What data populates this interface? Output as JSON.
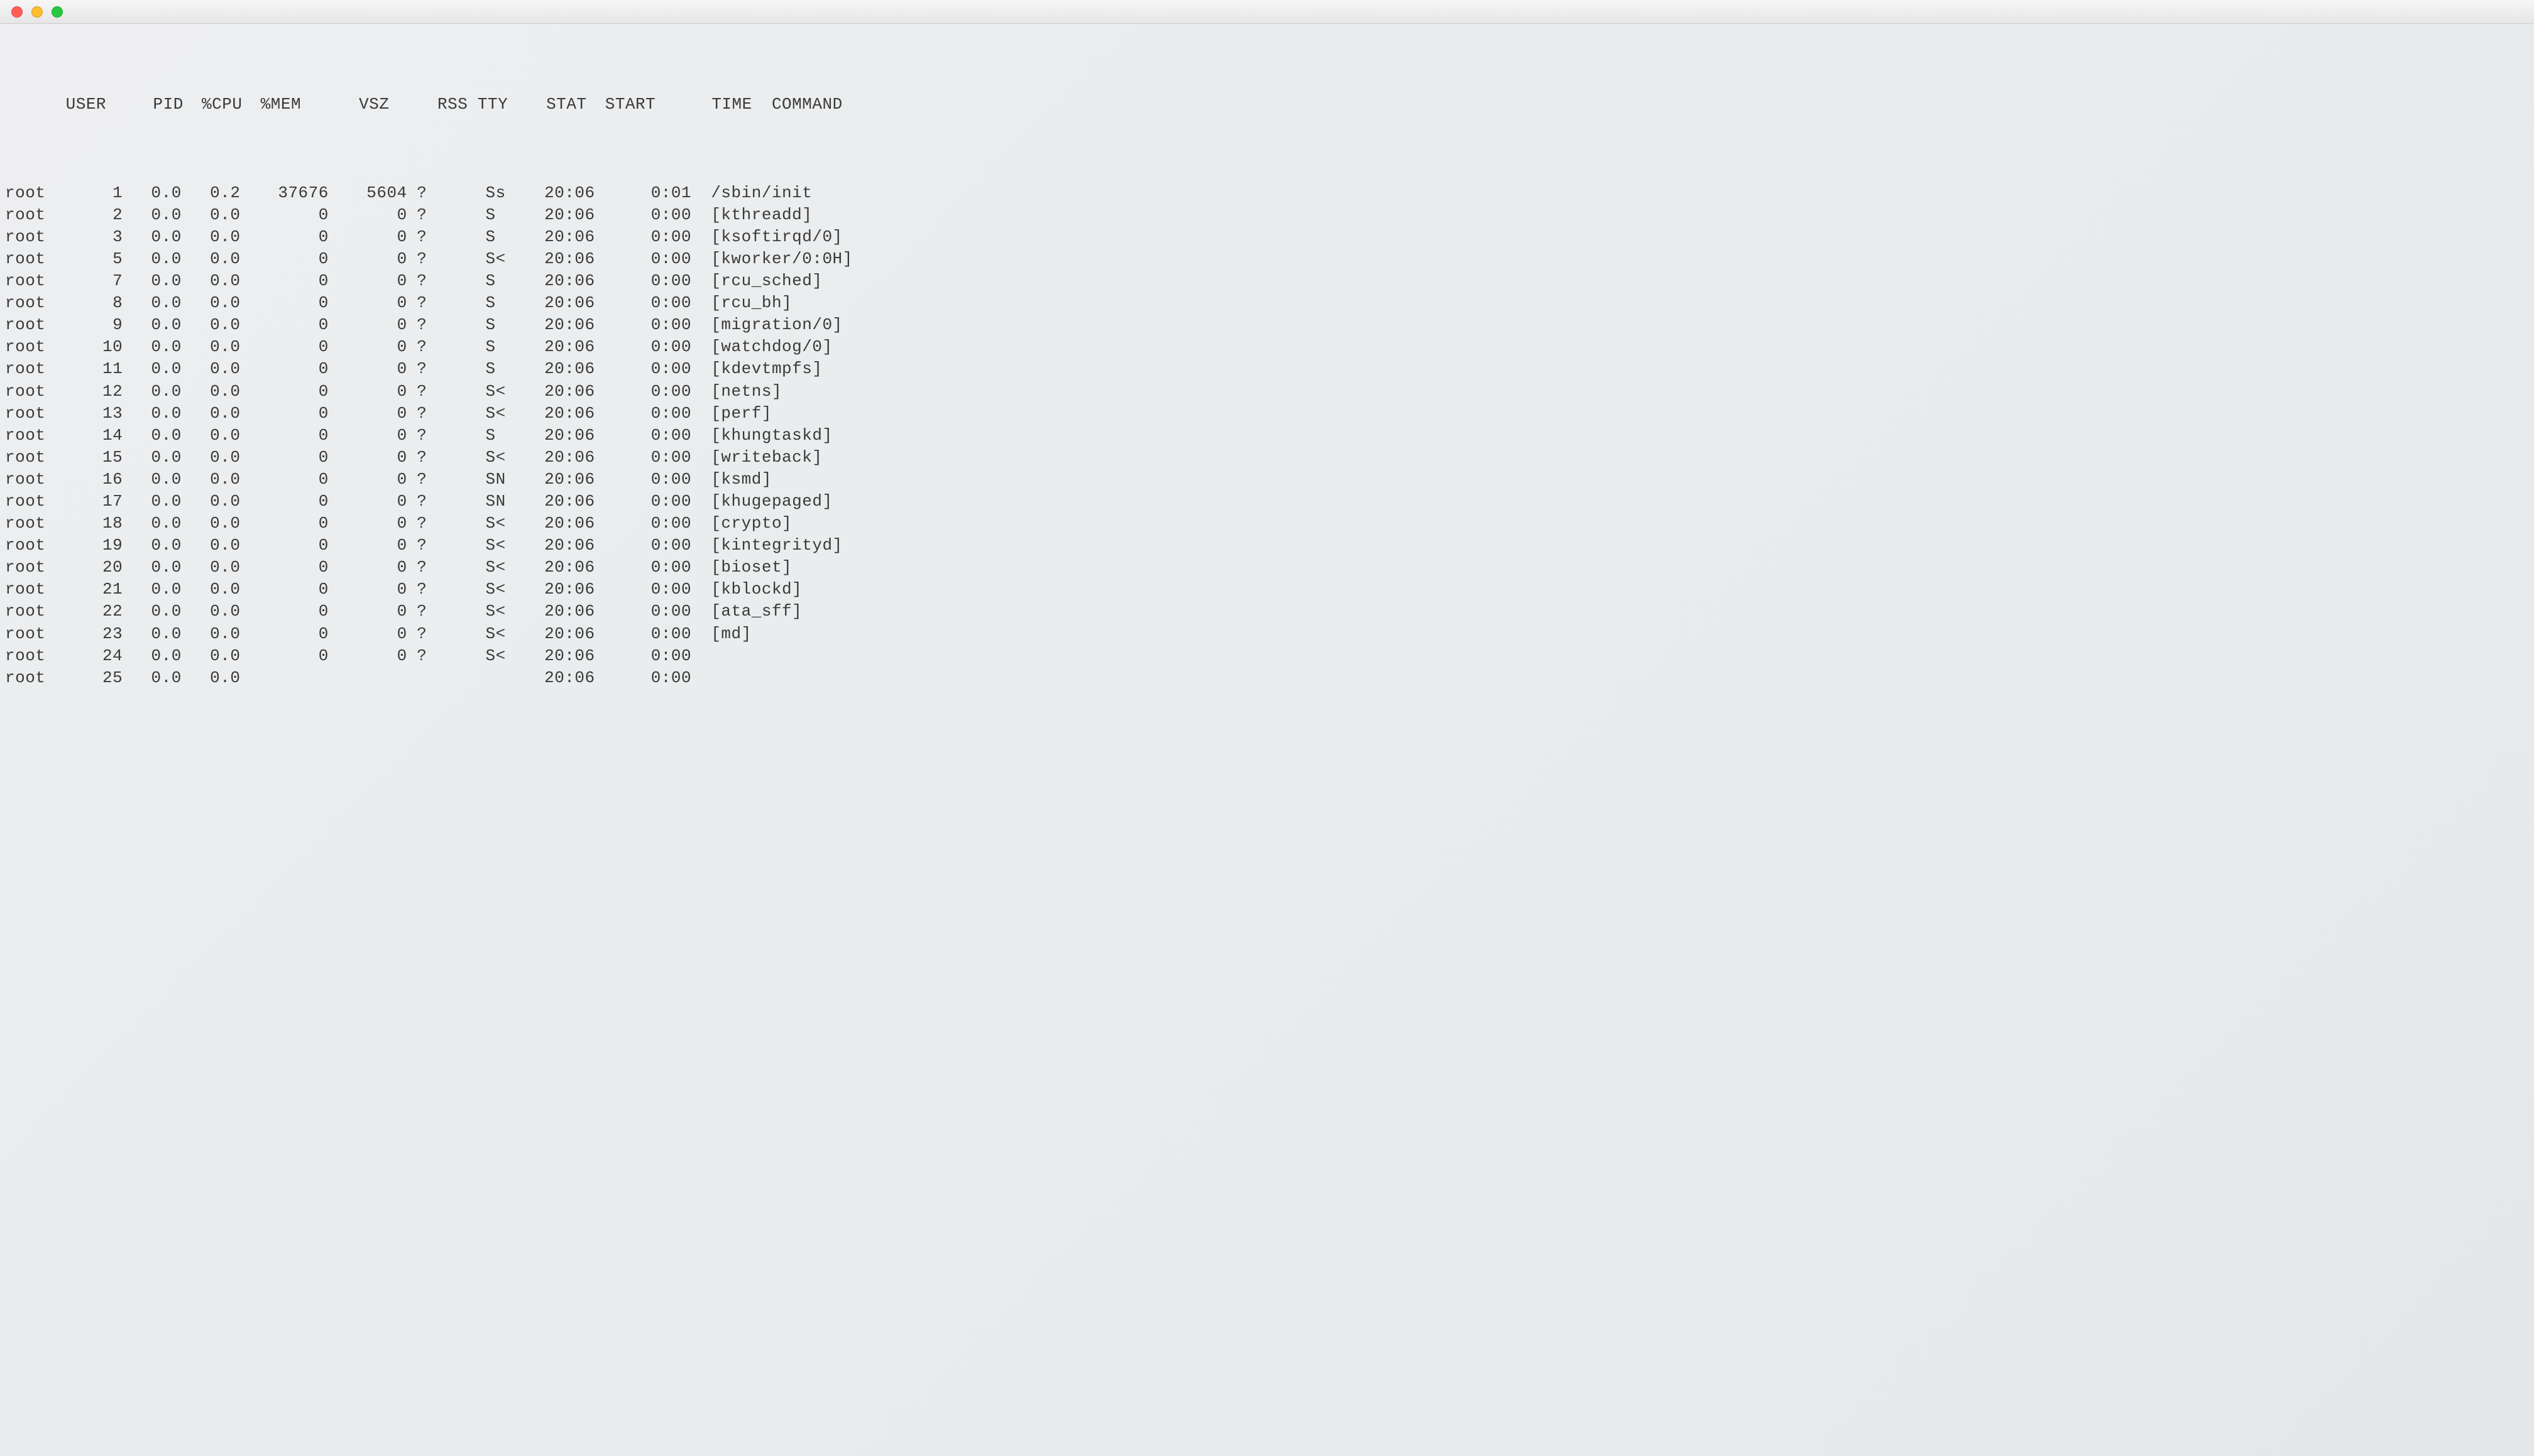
{
  "columns": {
    "user": "USER",
    "pid": "PID",
    "cpu": "%CPU",
    "mem": "%MEM",
    "vsz": "VSZ",
    "rss": "RSS",
    "tty": "TTY",
    "stat": "STAT",
    "start": "START",
    "time": "TIME",
    "cmd": "COMMAND"
  },
  "processes": [
    {
      "user": "root",
      "pid": "1",
      "cpu": "0.0",
      "mem": "0.2",
      "vsz": "37676",
      "rss": "5604",
      "tty": "?",
      "stat": "Ss",
      "start": "20:06",
      "time": "0:01",
      "cmd": "/sbin/init"
    },
    {
      "user": "root",
      "pid": "2",
      "cpu": "0.0",
      "mem": "0.0",
      "vsz": "0",
      "rss": "0",
      "tty": "?",
      "stat": "S",
      "start": "20:06",
      "time": "0:00",
      "cmd": "[kthreadd]"
    },
    {
      "user": "root",
      "pid": "3",
      "cpu": "0.0",
      "mem": "0.0",
      "vsz": "0",
      "rss": "0",
      "tty": "?",
      "stat": "S",
      "start": "20:06",
      "time": "0:00",
      "cmd": "[ksoftirqd/0]"
    },
    {
      "user": "root",
      "pid": "5",
      "cpu": "0.0",
      "mem": "0.0",
      "vsz": "0",
      "rss": "0",
      "tty": "?",
      "stat": "S<",
      "start": "20:06",
      "time": "0:00",
      "cmd": "[kworker/0:0H]"
    },
    {
      "user": "root",
      "pid": "7",
      "cpu": "0.0",
      "mem": "0.0",
      "vsz": "0",
      "rss": "0",
      "tty": "?",
      "stat": "S",
      "start": "20:06",
      "time": "0:00",
      "cmd": "[rcu_sched]"
    },
    {
      "user": "root",
      "pid": "8",
      "cpu": "0.0",
      "mem": "0.0",
      "vsz": "0",
      "rss": "0",
      "tty": "?",
      "stat": "S",
      "start": "20:06",
      "time": "0:00",
      "cmd": "[rcu_bh]"
    },
    {
      "user": "root",
      "pid": "9",
      "cpu": "0.0",
      "mem": "0.0",
      "vsz": "0",
      "rss": "0",
      "tty": "?",
      "stat": "S",
      "start": "20:06",
      "time": "0:00",
      "cmd": "[migration/0]"
    },
    {
      "user": "root",
      "pid": "10",
      "cpu": "0.0",
      "mem": "0.0",
      "vsz": "0",
      "rss": "0",
      "tty": "?",
      "stat": "S",
      "start": "20:06",
      "time": "0:00",
      "cmd": "[watchdog/0]"
    },
    {
      "user": "root",
      "pid": "11",
      "cpu": "0.0",
      "mem": "0.0",
      "vsz": "0",
      "rss": "0",
      "tty": "?",
      "stat": "S",
      "start": "20:06",
      "time": "0:00",
      "cmd": "[kdevtmpfs]"
    },
    {
      "user": "root",
      "pid": "12",
      "cpu": "0.0",
      "mem": "0.0",
      "vsz": "0",
      "rss": "0",
      "tty": "?",
      "stat": "S<",
      "start": "20:06",
      "time": "0:00",
      "cmd": "[netns]"
    },
    {
      "user": "root",
      "pid": "13",
      "cpu": "0.0",
      "mem": "0.0",
      "vsz": "0",
      "rss": "0",
      "tty": "?",
      "stat": "S<",
      "start": "20:06",
      "time": "0:00",
      "cmd": "[perf]"
    },
    {
      "user": "root",
      "pid": "14",
      "cpu": "0.0",
      "mem": "0.0",
      "vsz": "0",
      "rss": "0",
      "tty": "?",
      "stat": "S",
      "start": "20:06",
      "time": "0:00",
      "cmd": "[khungtaskd]"
    },
    {
      "user": "root",
      "pid": "15",
      "cpu": "0.0",
      "mem": "0.0",
      "vsz": "0",
      "rss": "0",
      "tty": "?",
      "stat": "S<",
      "start": "20:06",
      "time": "0:00",
      "cmd": "[writeback]"
    },
    {
      "user": "root",
      "pid": "16",
      "cpu": "0.0",
      "mem": "0.0",
      "vsz": "0",
      "rss": "0",
      "tty": "?",
      "stat": "SN",
      "start": "20:06",
      "time": "0:00",
      "cmd": "[ksmd]"
    },
    {
      "user": "root",
      "pid": "17",
      "cpu": "0.0",
      "mem": "0.0",
      "vsz": "0",
      "rss": "0",
      "tty": "?",
      "stat": "SN",
      "start": "20:06",
      "time": "0:00",
      "cmd": "[khugepaged]"
    },
    {
      "user": "root",
      "pid": "18",
      "cpu": "0.0",
      "mem": "0.0",
      "vsz": "0",
      "rss": "0",
      "tty": "?",
      "stat": "S<",
      "start": "20:06",
      "time": "0:00",
      "cmd": "[crypto]"
    },
    {
      "user": "root",
      "pid": "19",
      "cpu": "0.0",
      "mem": "0.0",
      "vsz": "0",
      "rss": "0",
      "tty": "?",
      "stat": "S<",
      "start": "20:06",
      "time": "0:00",
      "cmd": "[kintegrityd]"
    },
    {
      "user": "root",
      "pid": "20",
      "cpu": "0.0",
      "mem": "0.0",
      "vsz": "0",
      "rss": "0",
      "tty": "?",
      "stat": "S<",
      "start": "20:06",
      "time": "0:00",
      "cmd": "[bioset]"
    },
    {
      "user": "root",
      "pid": "21",
      "cpu": "0.0",
      "mem": "0.0",
      "vsz": "0",
      "rss": "0",
      "tty": "?",
      "stat": "S<",
      "start": "20:06",
      "time": "0:00",
      "cmd": "[kblockd]"
    },
    {
      "user": "root",
      "pid": "22",
      "cpu": "0.0",
      "mem": "0.0",
      "vsz": "0",
      "rss": "0",
      "tty": "?",
      "stat": "S<",
      "start": "20:06",
      "time": "0:00",
      "cmd": "[ata_sff]"
    },
    {
      "user": "root",
      "pid": "23",
      "cpu": "0.0",
      "mem": "0.0",
      "vsz": "0",
      "rss": "0",
      "tty": "?",
      "stat": "S<",
      "start": "20:06",
      "time": "0:00",
      "cmd": "[md]"
    },
    {
      "user": "root",
      "pid": "24",
      "cpu": "0.0",
      "mem": "0.0",
      "vsz": "0",
      "rss": "0",
      "tty": "?",
      "stat": "S<",
      "start": "20:06",
      "time": "0:00",
      "cmd": ""
    },
    {
      "user": "root",
      "pid": "25",
      "cpu": "0.0",
      "mem": "0.0",
      "vsz": "",
      "rss": "",
      "tty": "",
      "stat": "",
      "start": "20:06",
      "time": "0:00",
      "cmd": ""
    }
  ]
}
